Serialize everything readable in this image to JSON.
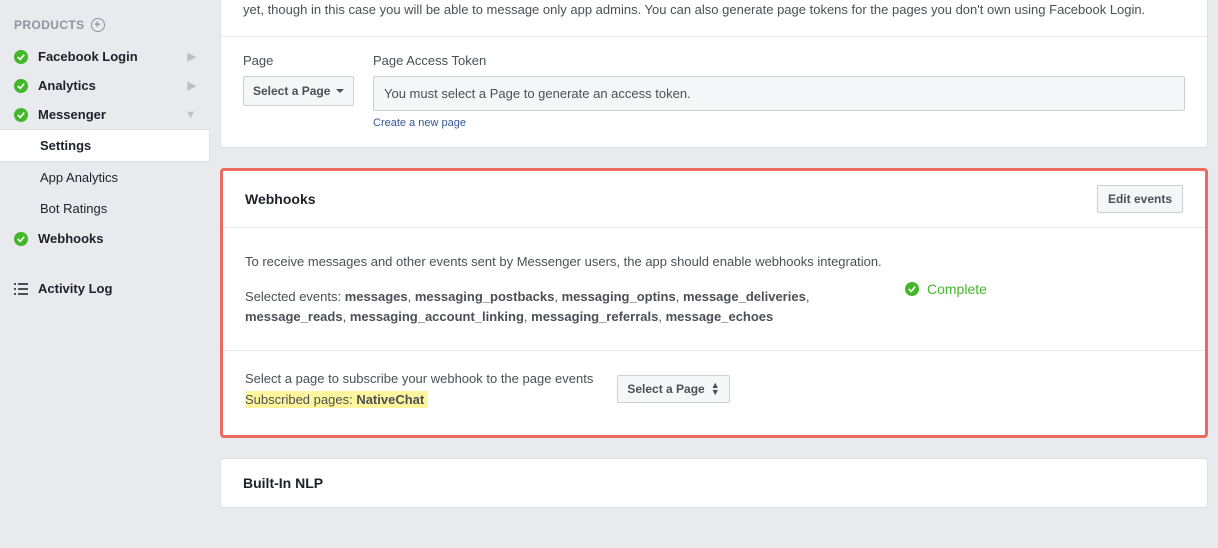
{
  "sidebar": {
    "heading": "PRODUCTS",
    "items": [
      {
        "label": "Facebook Login",
        "chev": "right"
      },
      {
        "label": "Analytics",
        "chev": "right"
      },
      {
        "label": "Messenger",
        "chev": "down"
      }
    ],
    "sub_items": [
      {
        "label": "Settings",
        "active": true
      },
      {
        "label": "App Analytics"
      },
      {
        "label": "Bot Ratings"
      }
    ],
    "webhooks_label": "Webhooks",
    "activity_log_label": "Activity Log"
  },
  "page_token": {
    "intro_text": "yet, though in this case you will be able to message only app admins. You can also generate page tokens for the pages you don't own using Facebook Login.",
    "page_label": "Page",
    "token_label": "Page Access Token",
    "select_page_label": "Select a Page",
    "token_placeholder": "You must select a Page to generate an access token.",
    "create_page_link": "Create a new page"
  },
  "webhooks": {
    "title": "Webhooks",
    "edit_events_label": "Edit events",
    "description": "To receive messages and other events sent by Messenger users, the app should enable webhooks integration.",
    "selected_events_label": "Selected events:",
    "selected_events": [
      "messages",
      "messaging_postbacks",
      "messaging_optins",
      "message_deliveries",
      "message_reads",
      "messaging_account_linking",
      "messaging_referrals",
      "message_echoes"
    ],
    "status_label": "Complete",
    "subscribe_text": "Select a page to subscribe your webhook to the page events",
    "subscribed_pages_label": "Subscribed pages:",
    "subscribed_page": "NativeChat",
    "select_page_label": "Select a Page"
  },
  "nlp": {
    "title": "Built-In NLP"
  }
}
